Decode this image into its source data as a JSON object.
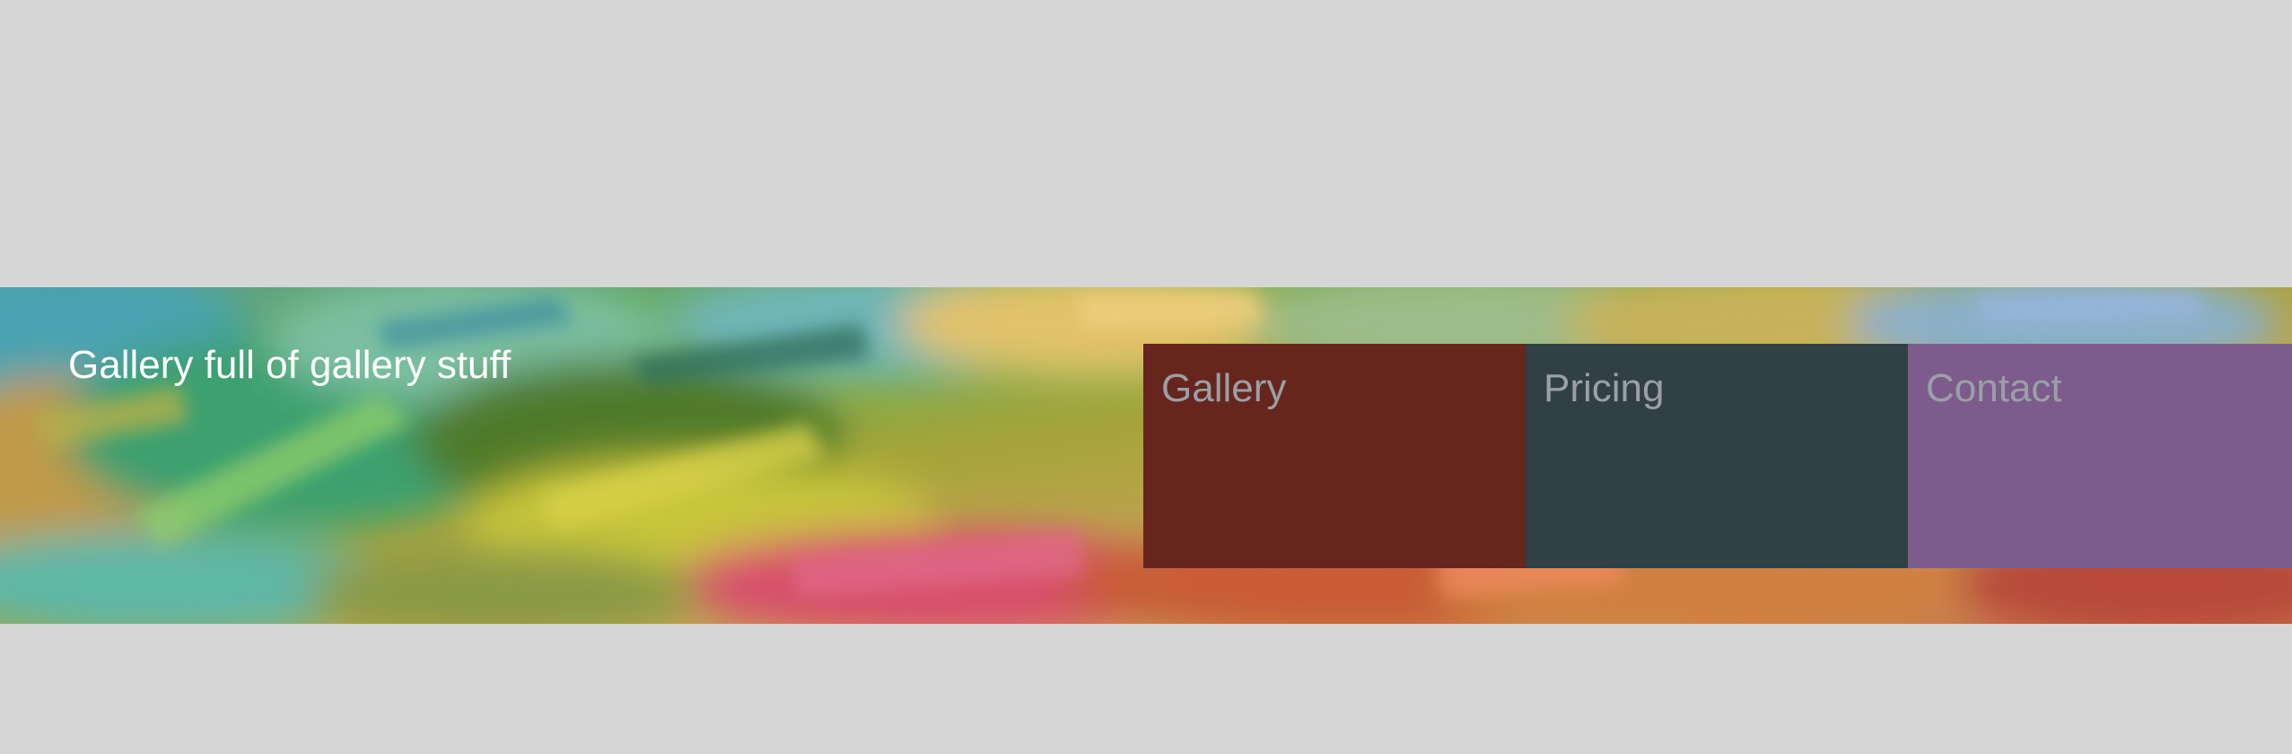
{
  "header": {
    "title": "Gallery full of gallery stuff"
  },
  "nav": {
    "items": [
      {
        "label": "Gallery",
        "color": "#66261e"
      },
      {
        "label": "Pricing",
        "color": "#314044"
      },
      {
        "label": "Contact",
        "color": "#7d5b8c"
      }
    ],
    "label_color": "#9aa0a6"
  },
  "banner": {
    "image": "abstract-painting-background"
  },
  "colors": {
    "page_background": "#d6d6d6",
    "title_text": "#ffffff"
  }
}
